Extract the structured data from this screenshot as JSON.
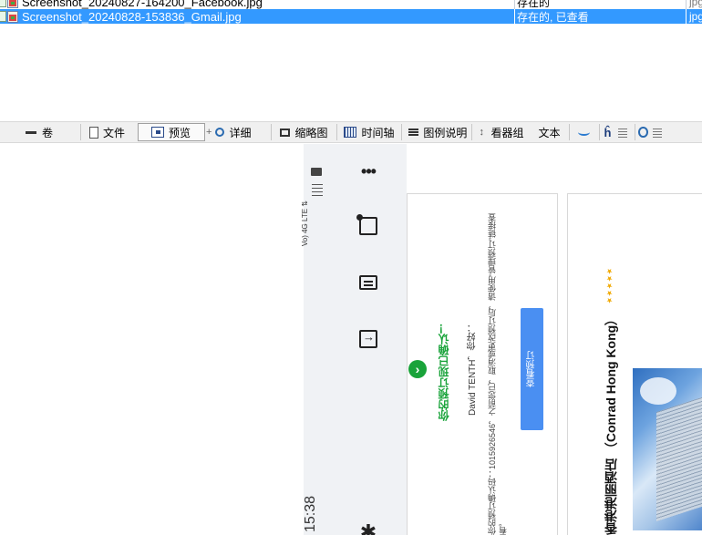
{
  "file_list": {
    "rows": [
      {
        "name": "Screenshot_20240827-164200_Facebook.jpg",
        "status": "存在的",
        "type": "jpg"
      },
      {
        "name": "Screenshot_20240828-153836_Gmail.jpg",
        "status": "存在的, 已查看",
        "type": "jpg",
        "selected": true
      }
    ]
  },
  "toolbar": {
    "volume_label": "卷",
    "file_label": "文件",
    "preview_label": "预览",
    "details_label": "详细",
    "thumbnails_label": "缩略图",
    "timeline_label": "时间轴",
    "legend_label": "图例说明",
    "viewer_group_label": "看器组",
    "text_label": "文本"
  },
  "phone": {
    "status_text": "Vo) 4G LTE ⇅",
    "clock": "15:38",
    "rail_more": "•••",
    "rail_star": "✱"
  },
  "email": {
    "confirm_title": "你的预订现已确认！",
    "greeting": "David TENTH，你好：",
    "booking_line": "你的预订确认码：1015926546，之前您已，取消或更改预订后，请使用“管理预订”链接查看。",
    "booking_button": "查看预订",
    "stars": "★★★★★",
    "hotel_name": "香港港丽酒店 （Conrad Hong Kong）"
  },
  "colors": {
    "selection": "#3399ff",
    "confirm_green": "#19a33a",
    "button_blue": "#4a8ff2"
  }
}
